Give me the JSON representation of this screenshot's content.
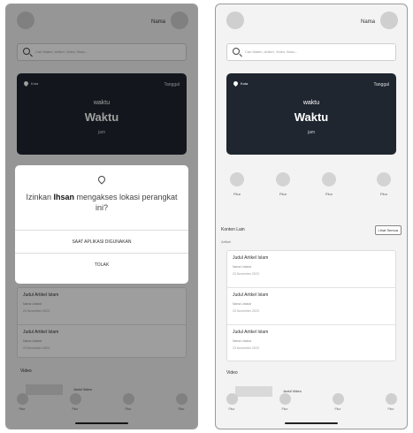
{
  "header": {
    "name_label": "Nama"
  },
  "search": {
    "placeholder": "Cari Materi, Artikel, Video, Buku..."
  },
  "card": {
    "location": "Kota",
    "date": "Tanggal",
    "label_small": "waktu",
    "label_big": "Waktu",
    "jam": "jam"
  },
  "features": [
    "Fitur",
    "Fitur",
    "Fitur",
    "Fitur"
  ],
  "content": {
    "title": "Konten Lain",
    "see_all": "Lihat Semua",
    "article_section": "Artikel",
    "video_section": "Video"
  },
  "articles": [
    {
      "title": "Judul Artikel Islam",
      "author": "Nama Ustadz",
      "date": "23 November 2023"
    },
    {
      "title": "Judul Artikel Islam",
      "author": "Nama Ustadz",
      "date": "23 November 2023"
    },
    {
      "title": "Judul Artikel Islam",
      "author": "Nama Ustadz",
      "date": "23 November 2023"
    }
  ],
  "video": {
    "title": "Judul Video"
  },
  "nav": [
    "Fitur",
    "Fitur",
    "Fitur",
    "Fitur"
  ],
  "dialog": {
    "pre": "Izinkan ",
    "app": "Ihsan",
    "post": " mengakses lokasi perangkat ini?",
    "allow": "SAAT APLIKASI DIGUNAKAN",
    "deny": "TOLAK"
  }
}
